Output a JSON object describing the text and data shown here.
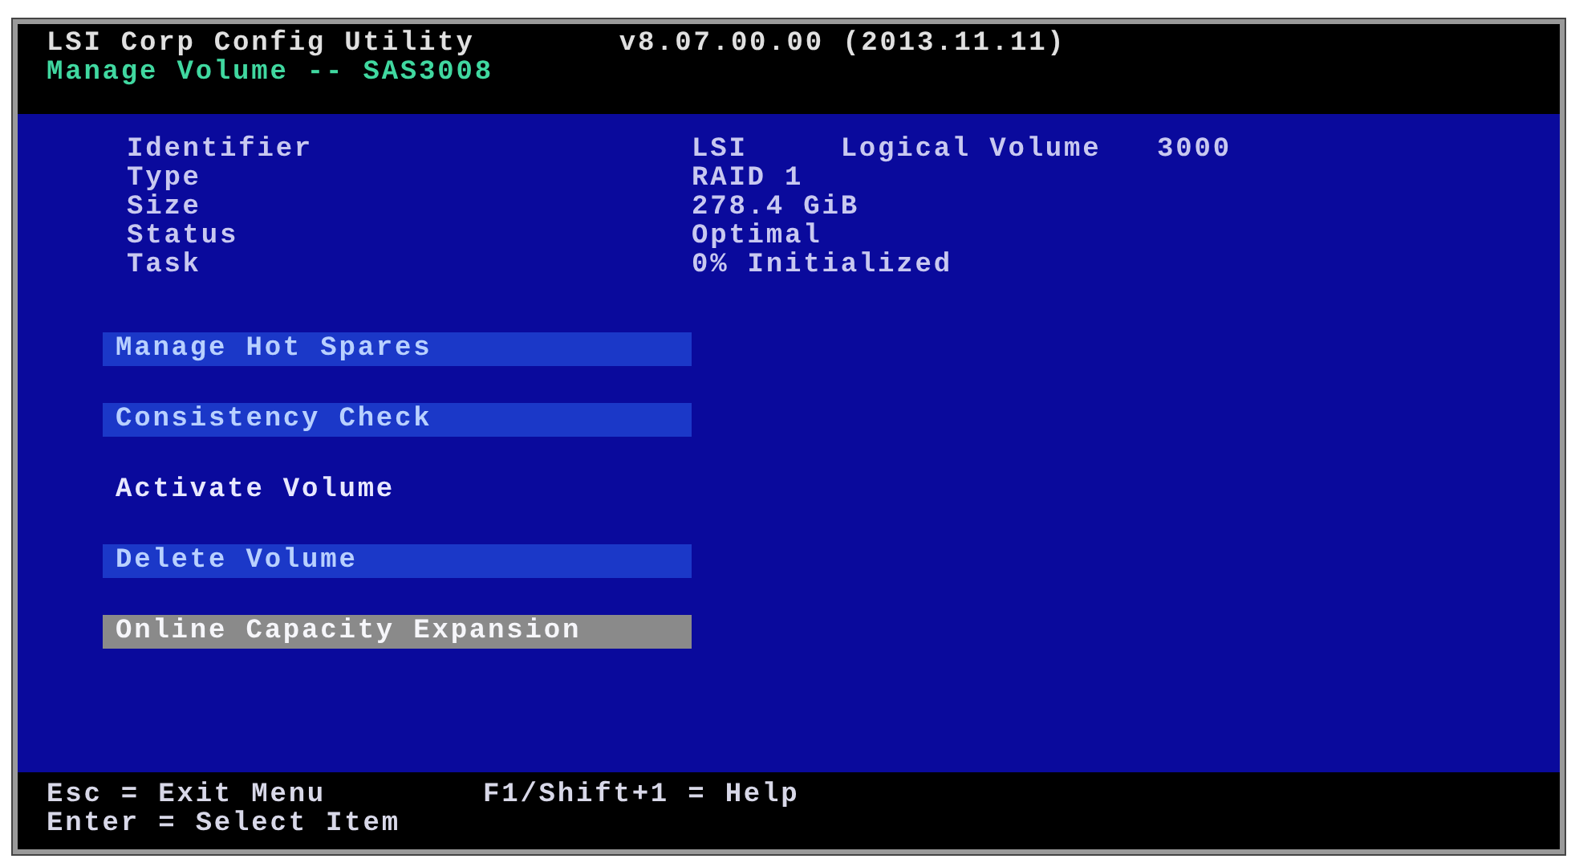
{
  "header": {
    "title": "LSI Corp Config Utility",
    "version": "v8.07.00.00 (2013.11.11)",
    "subtitle": "Manage Volume -- SAS3008"
  },
  "properties": [
    {
      "label": "Identifier",
      "value": "LSI     Logical Volume   3000"
    },
    {
      "label": "Type",
      "value": "RAID 1"
    },
    {
      "label": "Size",
      "value": "278.4 GiB"
    },
    {
      "label": "Status",
      "value": "Optimal"
    },
    {
      "label": "Task",
      "value": "0% Initialized"
    }
  ],
  "menu": [
    {
      "label": "Manage Hot Spares",
      "highlighted": true,
      "disabled": false
    },
    {
      "label": "Consistency Check",
      "highlighted": true,
      "disabled": false
    },
    {
      "label": "Activate Volume",
      "highlighted": false,
      "disabled": false
    },
    {
      "label": "Delete Volume",
      "highlighted": true,
      "disabled": false
    },
    {
      "label": "Online Capacity Expansion",
      "highlighted": false,
      "disabled": true
    }
  ],
  "footer": [
    [
      "Esc = Exit Menu",
      "F1/Shift+1 = Help"
    ],
    [
      "Enter = Select Item"
    ]
  ]
}
